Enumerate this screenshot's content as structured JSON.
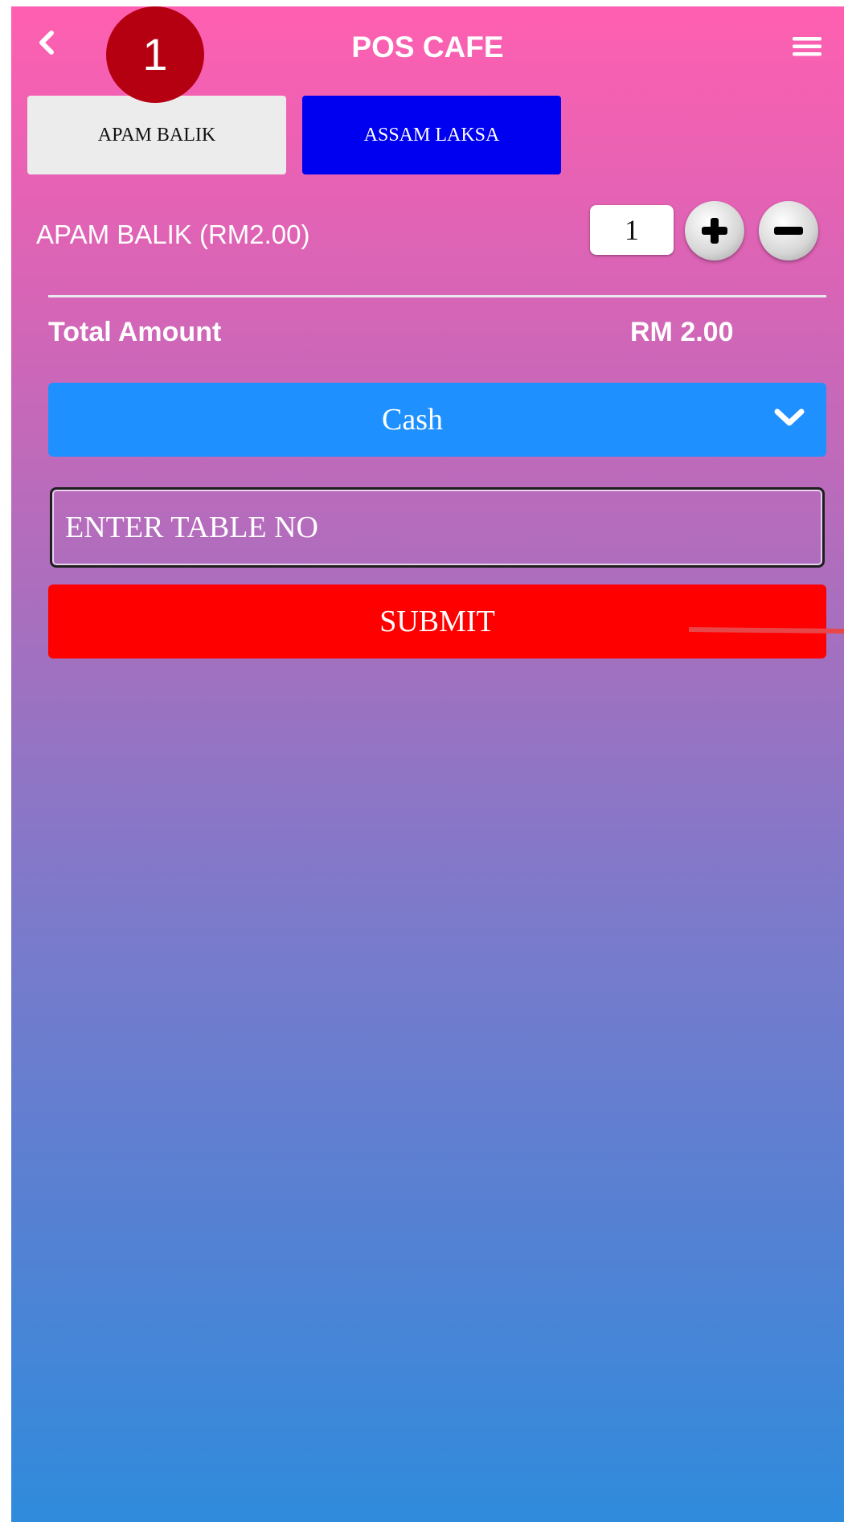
{
  "header": {
    "title": "POS CAFE"
  },
  "step_badge": "1",
  "tabs": [
    {
      "label": "APAM BALIK",
      "color": "#ececec"
    },
    {
      "label": "ASSAM LAKSA",
      "color": "#0000f0"
    }
  ],
  "order_item": {
    "label": "APAM BALIK (RM2.00)",
    "quantity": "1"
  },
  "total": {
    "label": "Total Amount",
    "value": "RM 2.00"
  },
  "payment": {
    "selected": "Cash"
  },
  "table_input": {
    "placeholder": "ENTER TABLE NO",
    "value": ""
  },
  "submit": {
    "label": "SUBMIT",
    "color": "#ff0000"
  },
  "colors": {
    "gradient_top": "#ff5fb0",
    "gradient_bottom": "#2f8bdc",
    "payment_select": "#1e90ff",
    "badge": "#b50012"
  },
  "icons": [
    "back-icon",
    "hamburger-menu-icon",
    "plus-icon",
    "minus-icon",
    "chevron-down-icon"
  ]
}
